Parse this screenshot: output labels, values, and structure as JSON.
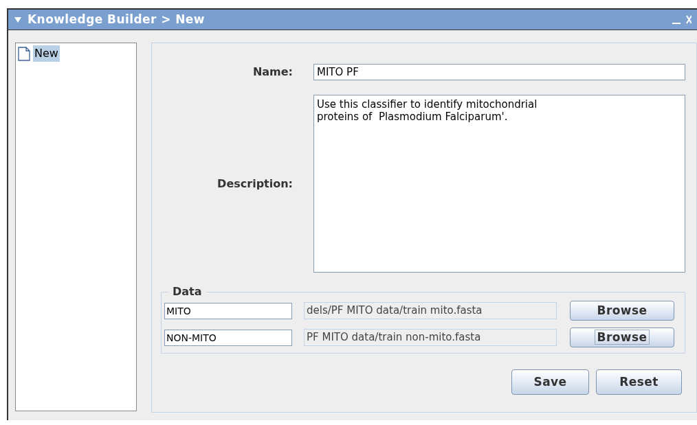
{
  "window": {
    "title": "Knowledge Builder > New"
  },
  "sidebar": {
    "items": [
      {
        "label": "New",
        "selected": true
      }
    ]
  },
  "form": {
    "name_label": "Name:",
    "name_value": "MITO PF",
    "description_label": "Description:",
    "description_value": "Use this classifier to identify mitochondrial\nproteins of  Plasmodium Falciparum'."
  },
  "data": {
    "title": "Data",
    "rows": [
      {
        "label": "MITO",
        "path": "dels/PF MITO data/train mito.fasta",
        "button": "Browse",
        "focused": false
      },
      {
        "label": "NON-MITO",
        "path": "PF MITO data/train non-mito.fasta",
        "button": "Browse",
        "focused": true
      }
    ]
  },
  "buttons": [
    "Save",
    "Reset"
  ]
}
